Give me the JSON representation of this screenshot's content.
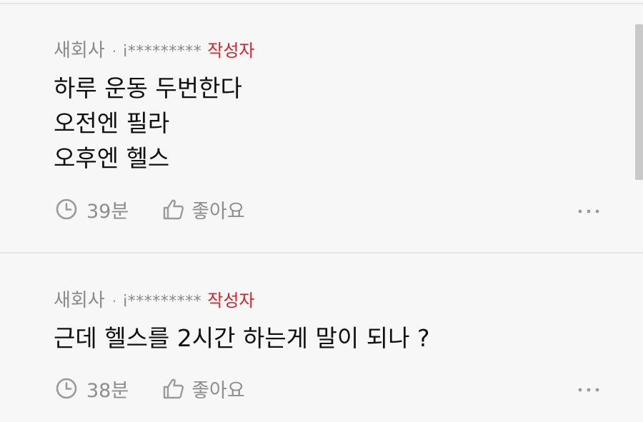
{
  "comments": [
    {
      "nickname": "새회사",
      "separator": "·",
      "user_id": "i*********",
      "author_badge": "작성자",
      "lines": [
        "하루 운동 두번한다",
        "오전엔 필라",
        "오후엔 헬스"
      ],
      "time": "39분",
      "like_label": "좋아요",
      "more_label": "···"
    },
    {
      "nickname": "새회사",
      "separator": "·",
      "user_id": "i*********",
      "author_badge": "작성자",
      "lines": [
        "근데 헬스를 2시간 하는게 말이 되나 ?"
      ],
      "time": "38분",
      "like_label": "좋아요",
      "more_label": "···"
    }
  ],
  "icons": {
    "time": "clock-icon",
    "like": "thumbs-up-icon",
    "more": "more-dots-icon"
  },
  "colors": {
    "background": "#f7f7f7",
    "author_badge": "#d8232a",
    "meta_text": "#8a8a8a",
    "body_text": "#111111"
  }
}
